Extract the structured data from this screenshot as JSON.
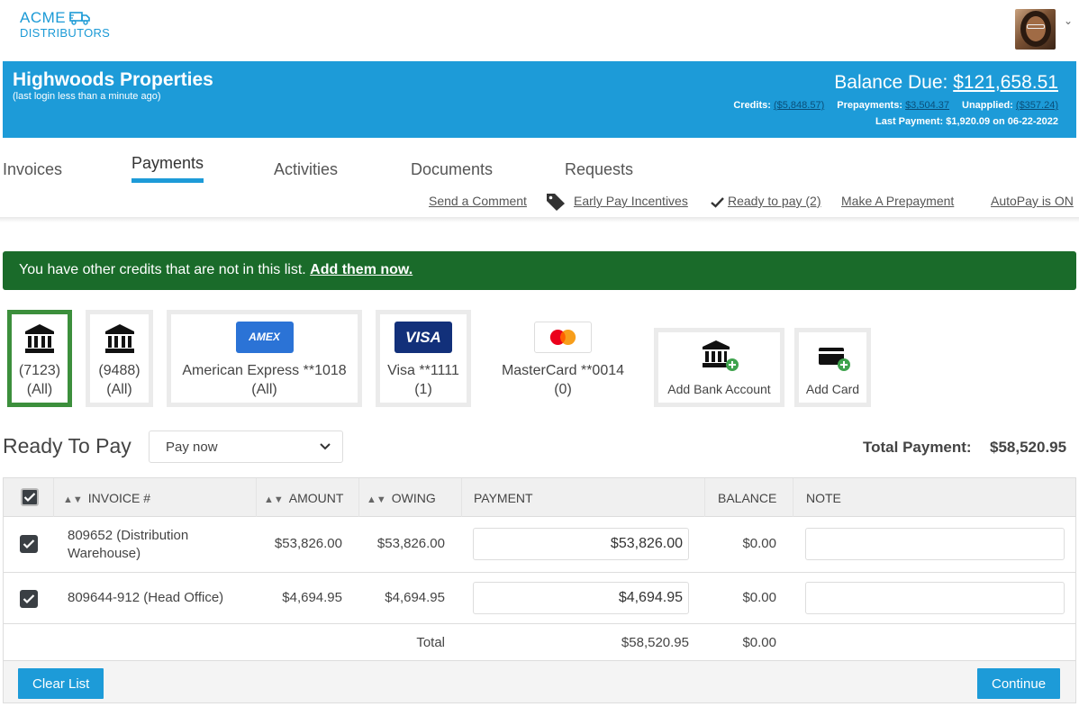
{
  "brand": {
    "line1": "ACME",
    "line2": "DISTRIBUTORS",
    "color": "#1b9ad6"
  },
  "header": {
    "company": "Highwoods Properties",
    "last_login": "(last login less than a minute ago)",
    "balance_label": "Balance Due:",
    "balance_value": "$121,658.51",
    "credits_label": "Credits:",
    "credits_value": "($5,848.57)",
    "prepayments_label": "Prepayments:",
    "prepayments_value": "$3,504.37",
    "unapplied_label": "Unapplied:",
    "unapplied_value": "($357.24)",
    "last_payment": "Last Payment: $1,920.09 on 06-22-2022",
    "bg_color": "#1d9bd8"
  },
  "tabs": [
    {
      "label": "Invoices"
    },
    {
      "label": "Payments",
      "active": true
    },
    {
      "label": "Activities"
    },
    {
      "label": "Documents"
    },
    {
      "label": "Requests"
    }
  ],
  "quick_links": {
    "send_comment": "Send a Comment",
    "early_pay": "Early Pay Incentives",
    "ready_to_pay": "Ready to pay (2)",
    "make_prepayment": "Make A Prepayment",
    "autopay": "AutoPay is ON"
  },
  "alert": {
    "text": "You have other credits that are not in this list.",
    "link": "Add them now.",
    "color": "#1a6b2a"
  },
  "payment_methods": [
    {
      "icon": "bank-icon",
      "line1": "(7123)",
      "line2": "(All)",
      "selected": true
    },
    {
      "icon": "bank-icon",
      "line1": "(9488)",
      "line2": "(All)"
    },
    {
      "icon": "amex-logo",
      "logo_text": "AMEX",
      "line1": "American Express **1018",
      "line2": "(All)"
    },
    {
      "icon": "visa-logo",
      "logo_text": "VISA",
      "line1": "Visa **1111",
      "line2": "(1)"
    },
    {
      "icon": "mastercard-logo",
      "line1": "MasterCard **0014",
      "line2": "(0)"
    },
    {
      "icon": "add-bank-icon",
      "line1": "Add Bank Account"
    },
    {
      "icon": "add-card-icon",
      "line1": "Add Card"
    }
  ],
  "ready_to_pay": {
    "title": "Ready To Pay",
    "schedule_selected": "Pay now",
    "total_label": "Total Payment:",
    "total_value": "$58,520.95"
  },
  "table": {
    "headers": {
      "invoice": "INVOICE #",
      "amount": "AMOUNT",
      "owing": "OWING",
      "payment": "PAYMENT",
      "balance": "BALANCE",
      "note": "NOTE"
    },
    "rows": [
      {
        "invoice_line1": "809652 (Distribution",
        "invoice_line2": "Warehouse)",
        "amount": "$53,826.00",
        "owing": "$53,826.00",
        "payment": "$53,826.00",
        "balance": "$0.00",
        "note": ""
      },
      {
        "invoice_line1": "809644-912 (Head Office)",
        "invoice_line2": "",
        "amount": "$4,694.95",
        "owing": "$4,694.95",
        "payment": "$4,694.95",
        "balance": "$0.00",
        "note": ""
      }
    ],
    "total_label": "Total",
    "total_payment": "$58,520.95",
    "total_balance": "$0.00"
  },
  "buttons": {
    "clear_list": "Clear List",
    "continue": "Continue"
  }
}
